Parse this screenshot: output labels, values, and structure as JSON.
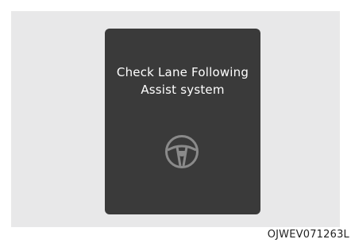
{
  "display": {
    "message_line1": "Check Lane Following",
    "message_line2": "Assist system",
    "icon": "steering-wheel-icon",
    "background_color": "#3a3a3a",
    "text_color": "#ffffff",
    "icon_color": "#8a8a8a"
  },
  "figure_code": "OJWEV071263L"
}
